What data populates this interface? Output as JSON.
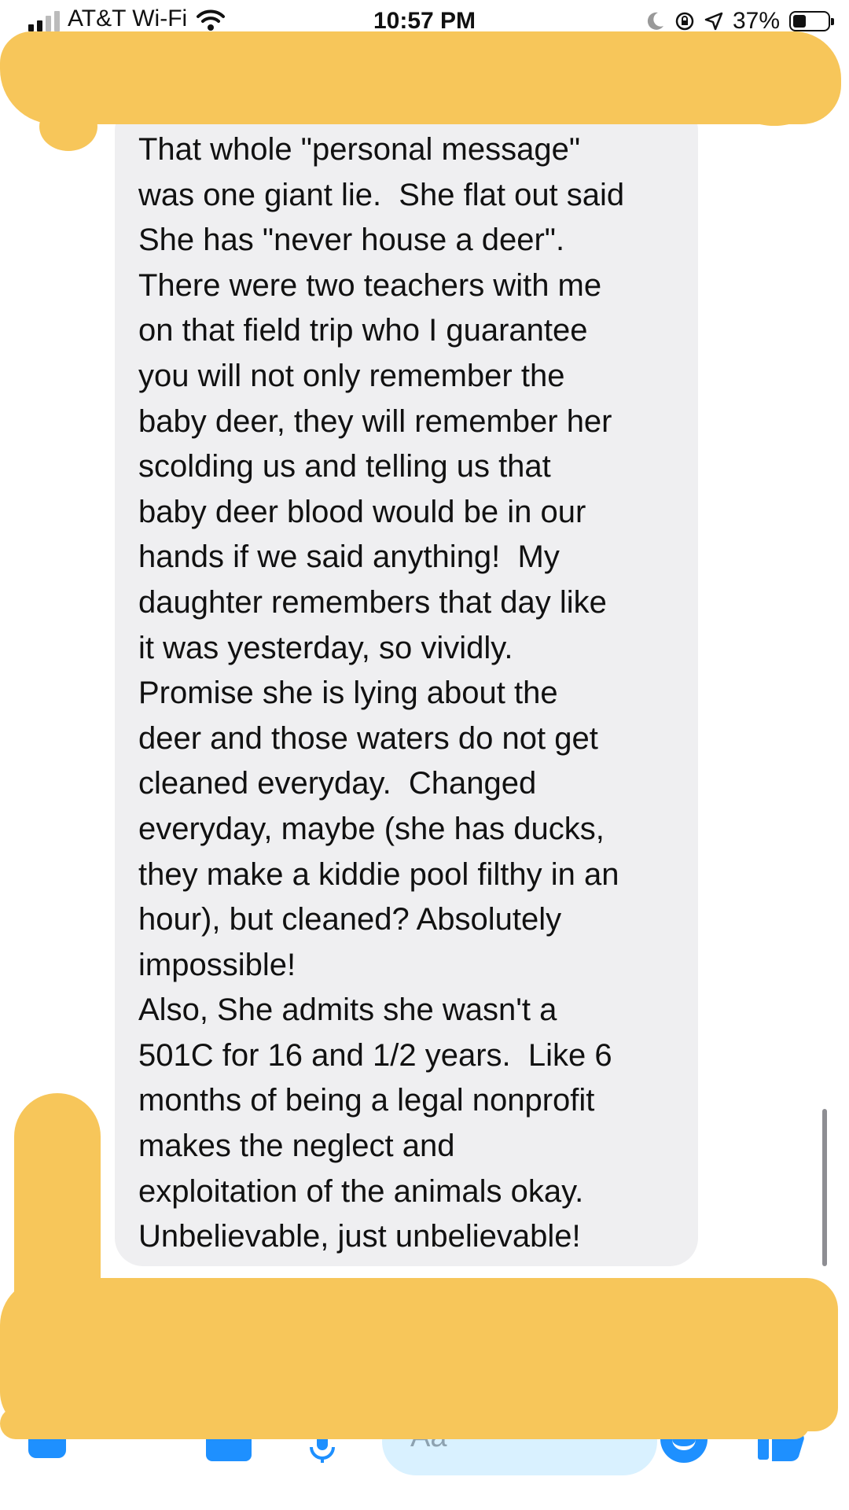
{
  "status_bar": {
    "carrier": "AT&T Wi-Fi",
    "time": "10:57 PM",
    "battery": "37%",
    "battery_level": 0.37
  },
  "message": {
    "text": "That whole \"personal message\"\nwas one giant lie.  She flat out said\nShe has \"never house a deer\".\nThere were two teachers with me\non that field trip who I guarantee\nyou will not only remember the\nbaby deer, they will remember her\nscolding us and telling us that\nbaby deer blood would be in our\nhands if we said anything!  My\ndaughter remembers that day like\nit was yesterday, so vividly.\nPromise she is lying about the\ndeer and those waters do not get\ncleaned everyday.  Changed\neveryday, maybe (she has ducks,\nthey make a kiddie pool filthy in an\nhour), but cleaned? Absolutely\nimpossible!\nAlso, She admits she wasn't a\n501C for 16 and 1/2 years.  Like 6\nmonths of being a legal nonprofit\nmakes the neglect and\nexploitation of the animals okay.\nUnbelievable, just unbelievable!"
  },
  "composer": {
    "placeholder": "Aa"
  },
  "icons": {
    "signal": "signal-bars-icon",
    "wifi": "wifi-icon",
    "moon": "do-not-disturb-moon-icon",
    "lock": "orientation-lock-icon",
    "location": "location-arrow-icon",
    "battery": "battery-icon",
    "camera": "camera-icon",
    "image": "image-icon",
    "mic": "microphone-icon",
    "emoji": "emoji-icon",
    "like": "thumbs-up-icon"
  },
  "colors": {
    "accent": "#1e90ff",
    "bubble": "#efeff1",
    "redaction": "#f7c65a"
  }
}
